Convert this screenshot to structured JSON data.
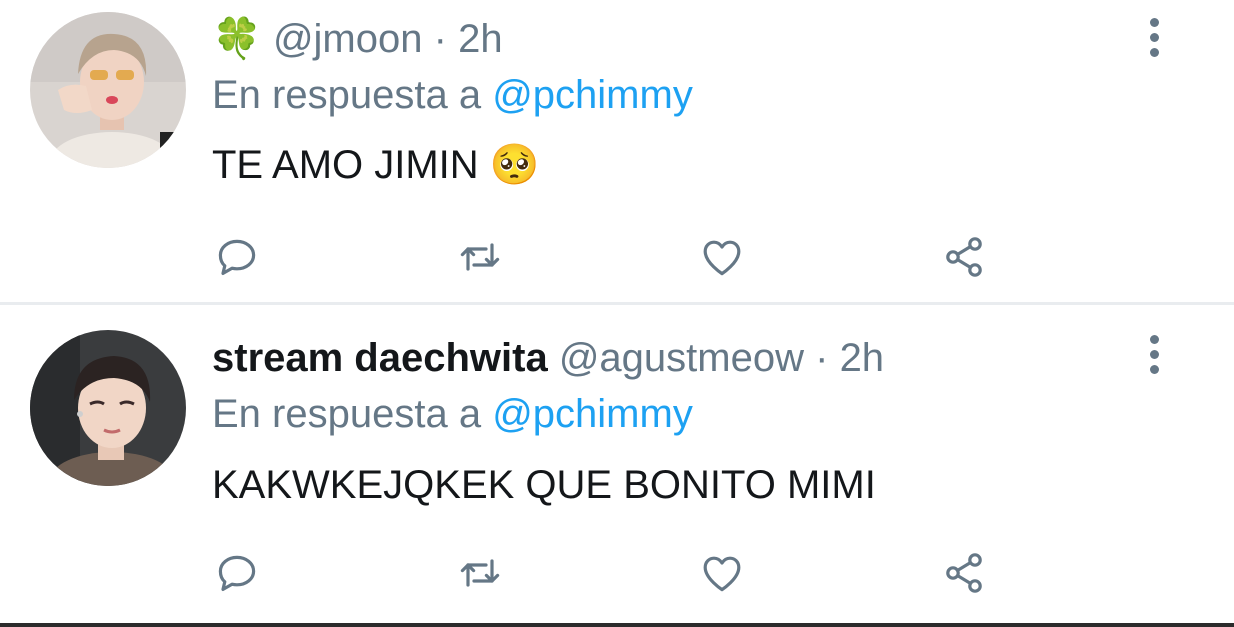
{
  "tweets": [
    {
      "display_name": "",
      "name_emoji": "🍀",
      "handle": "@jmoon",
      "separator": "·",
      "time": "2h",
      "reply_prefix": "En respuesta a",
      "reply_to": "@pchimmy",
      "text": "TE AMO JIMIN",
      "text_emoji": "🥺"
    },
    {
      "display_name": "stream daechwita",
      "name_emoji": "",
      "handle": "@agustmeow",
      "separator": "·",
      "time": "2h",
      "reply_prefix": "En respuesta a",
      "reply_to": "@pchimmy",
      "text": "KAKWKEJQKEK QUE BONITO MIMI",
      "text_emoji": ""
    }
  ],
  "icons": {
    "reply": "comment-icon",
    "retweet": "retweet-icon",
    "like": "heart-icon",
    "share": "share-icon",
    "menu": "more-vertical-icon"
  },
  "colors": {
    "text_primary": "#14171a",
    "text_secondary": "#657786",
    "accent": "#1da1f2",
    "divider": "#e9ecef"
  }
}
